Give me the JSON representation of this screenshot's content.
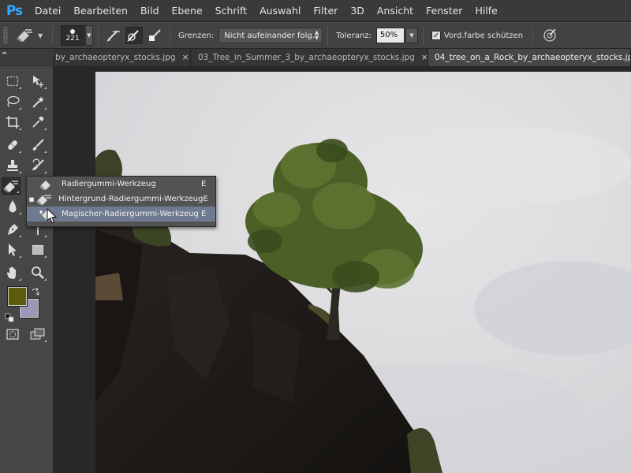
{
  "app": {
    "logo": "Ps"
  },
  "menu": [
    "Datei",
    "Bearbeiten",
    "Bild",
    "Ebene",
    "Schrift",
    "Auswahl",
    "Filter",
    "3D",
    "Ansicht",
    "Fenster",
    "Hilfe"
  ],
  "options": {
    "tool_icon": "background-eraser-icon",
    "brush_size": "221",
    "limits_label": "Grenzen:",
    "limits_value": "Nicht aufeinander folg.",
    "tolerance_label": "Toleranz:",
    "tolerance_value": "50%",
    "protect_fg_label": "Vord.farbe schützen",
    "protect_fg_checked": true
  },
  "tabs": [
    {
      "label": "by_archaeopteryx_stocks.jpg",
      "close": "×",
      "active": false
    },
    {
      "label": "03_Tree_in_Summer_3_by_archaeopteryx_stocks.jpg",
      "close": "×",
      "active": false
    },
    {
      "label": "04_tree_on_a_Rock_by_archaeopteryx_stocks.jpg",
      "close": "",
      "active": true
    }
  ],
  "panel_collapse": "◂◂",
  "tools": [
    "rectangular-marquee-icon",
    "move-icon",
    "lasso-icon",
    "magic-wand-icon",
    "crop-icon",
    "eyedropper-icon",
    "spot-healing-icon",
    "brush-icon",
    "clone-stamp-icon",
    "history-brush-icon",
    "eraser-icon",
    "gradient-icon",
    "blur-icon",
    "dodge-icon",
    "pen-icon",
    "type-icon",
    "path-selection-icon",
    "rectangle-shape-icon",
    "hand-icon",
    "zoom-icon",
    "quick-mask-icon",
    "screen-mode-icon"
  ],
  "colors": {
    "foreground": "#5c5b0b",
    "background": "#9a98b6"
  },
  "flyout": {
    "items": [
      {
        "label": "Radiergummi-Werkzeug",
        "shortcut": "E",
        "bullet": "",
        "icon": "eraser-icon"
      },
      {
        "label": "Hintergrund-Radiergummi-Werkzeug",
        "shortcut": "E",
        "bullet": "■",
        "icon": "background-eraser-icon"
      },
      {
        "label": "Magischer-Radiergummi-Werkzeug",
        "shortcut": "E",
        "bullet": "",
        "icon": "magic-eraser-icon"
      }
    ]
  }
}
